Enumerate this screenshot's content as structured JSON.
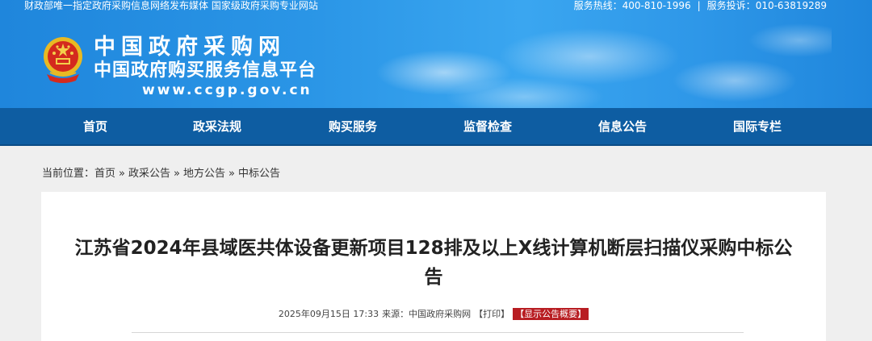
{
  "topbar": {
    "left_text": "财政部唯一指定政府采购信息网络发布媒体  国家级政府采购专业网站",
    "hotline_label": "服务热线：",
    "hotline": "400-810-1996",
    "separator": "|",
    "complaint_label": "服务投诉：",
    "complaint": "010-63819289"
  },
  "header": {
    "site_name": "中国政府采购网",
    "site_subname": "中国政府购买服务信息平台",
    "site_url": "www.ccgp.gov.cn",
    "emblem_icon": "national-emblem-icon",
    "brand_color": "#1f86dc"
  },
  "nav": {
    "color": "#0e5da2",
    "items": [
      {
        "label": "首页"
      },
      {
        "label": "政采法规"
      },
      {
        "label": "购买服务"
      },
      {
        "label": "监督检查"
      },
      {
        "label": "信息公告"
      },
      {
        "label": "国际专栏"
      }
    ]
  },
  "breadcrumb": {
    "prefix": "当前位置：",
    "items": [
      "首页",
      "政采公告",
      "地方公告",
      "中标公告"
    ],
    "separator": "»"
  },
  "article": {
    "title": "江苏省2024年县域医共体设备更新项目128排及以上X线计算机断层扫描仪采购中标公告",
    "date": "2025年09月15日 17:33",
    "source_label": "来源：",
    "source": "中国政府采购网",
    "print_label": "【打印】",
    "summary_label": "【显示公告概要】",
    "summary_color": "#b81d22"
  }
}
